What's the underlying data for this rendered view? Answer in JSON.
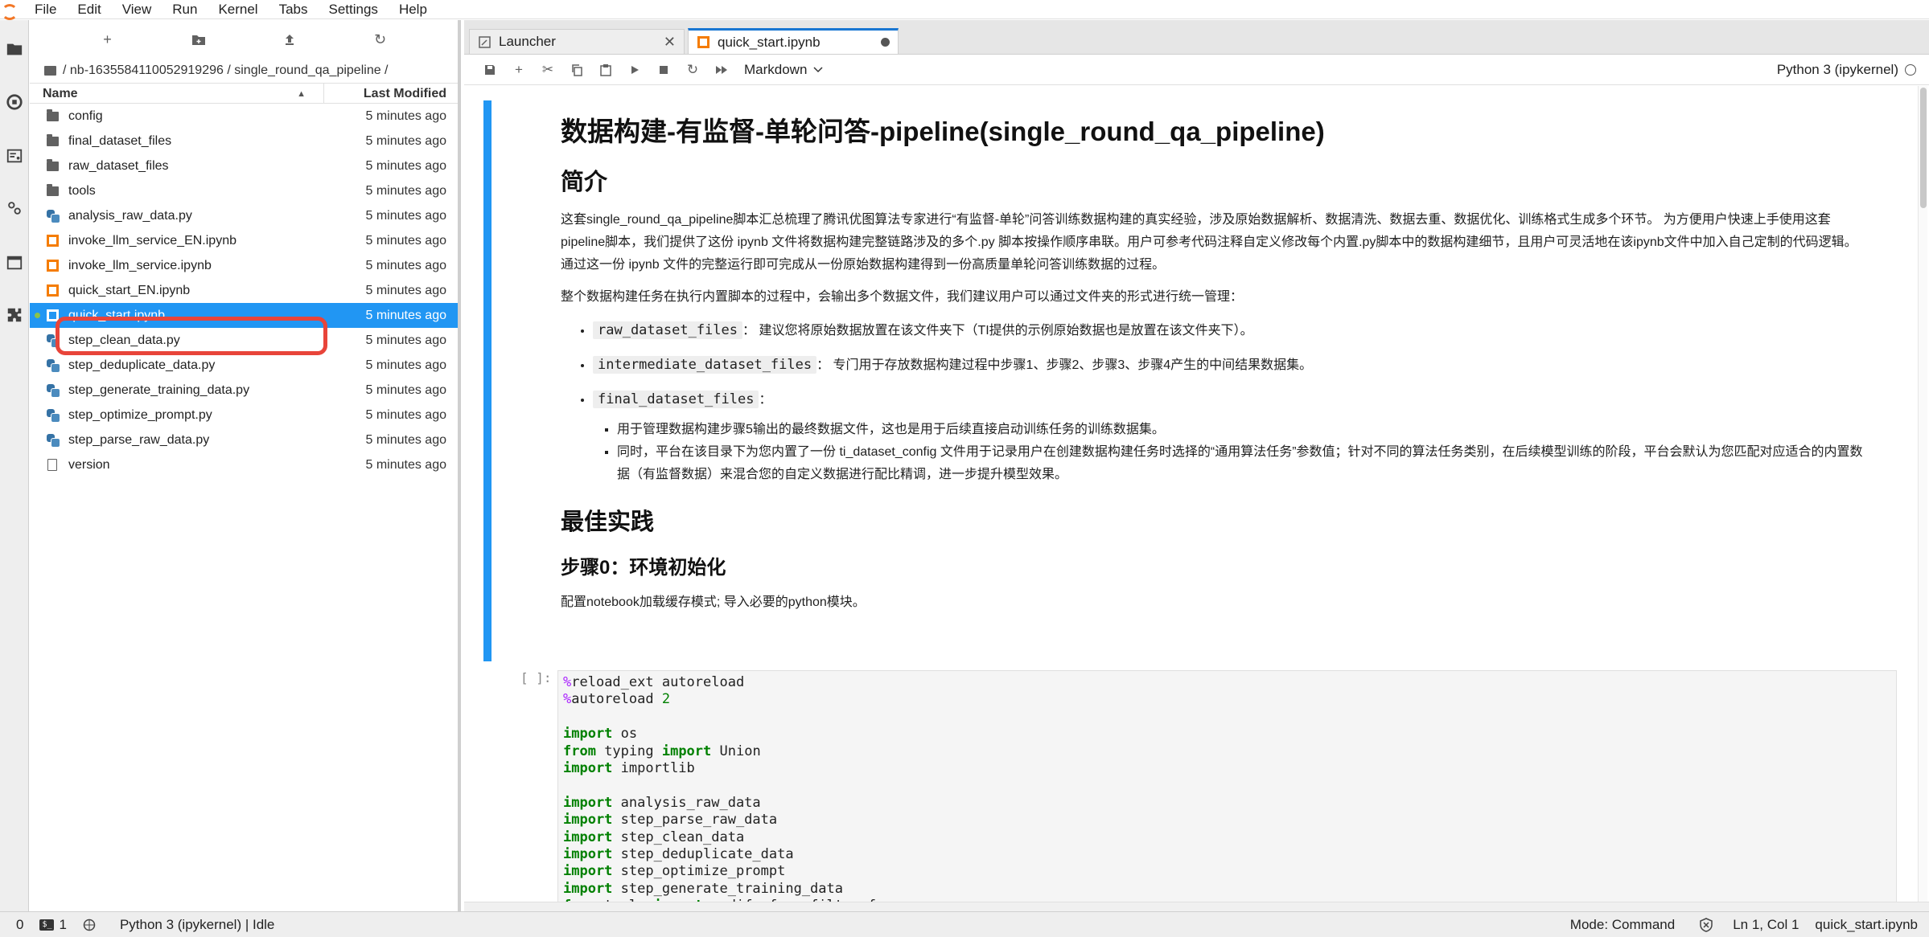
{
  "menu": [
    "File",
    "Edit",
    "View",
    "Run",
    "Kernel",
    "Tabs",
    "Settings",
    "Help"
  ],
  "filebrowser": {
    "path": "/ nb-1635584110052919296 / single_round_qa_pipeline /",
    "col_name": "Name",
    "col_modified": "Last Modified",
    "files": [
      {
        "name": "config",
        "type": "folder",
        "modified": "5 minutes ago"
      },
      {
        "name": "final_dataset_files",
        "type": "folder",
        "modified": "5 minutes ago"
      },
      {
        "name": "raw_dataset_files",
        "type": "folder",
        "modified": "5 minutes ago"
      },
      {
        "name": "tools",
        "type": "folder",
        "modified": "5 minutes ago"
      },
      {
        "name": "analysis_raw_data.py",
        "type": "python",
        "modified": "5 minutes ago"
      },
      {
        "name": "invoke_llm_service_EN.ipynb",
        "type": "notebook",
        "modified": "5 minutes ago"
      },
      {
        "name": "invoke_llm_service.ipynb",
        "type": "notebook",
        "modified": "5 minutes ago"
      },
      {
        "name": "quick_start_EN.ipynb",
        "type": "notebook",
        "modified": "5 minutes ago"
      },
      {
        "name": "quick_start.ipynb",
        "type": "notebook",
        "modified": "5 minutes ago",
        "selected": true
      },
      {
        "name": "step_clean_data.py",
        "type": "python",
        "modified": "5 minutes ago"
      },
      {
        "name": "step_deduplicate_data.py",
        "type": "python",
        "modified": "5 minutes ago"
      },
      {
        "name": "step_generate_training_data.py",
        "type": "python",
        "modified": "5 minutes ago"
      },
      {
        "name": "step_optimize_prompt.py",
        "type": "python",
        "modified": "5 minutes ago"
      },
      {
        "name": "step_parse_raw_data.py",
        "type": "python",
        "modified": "5 minutes ago"
      },
      {
        "name": "version",
        "type": "file",
        "modified": "5 minutes ago"
      }
    ]
  },
  "tabs": {
    "launcher": "Launcher",
    "notebook": "quick_start.ipynb"
  },
  "toolbar": {
    "cell_type": "Markdown",
    "kernel": "Python 3 (ipykernel)"
  },
  "markdown": {
    "h1": "数据构建-有监督-单轮问答-pipeline(single_round_qa_pipeline)",
    "h2_intro": "简介",
    "p1": "这套single_round_qa_pipeline脚本汇总梳理了腾讯优图算法专家进行“有监督-单轮”问答训练数据构建的真实经验，涉及原始数据解析、数据清洗、数据去重、数据优化、训练格式生成多个环节。 为方便用户快速上手使用这套pipeline脚本，我们提供了这份 ipynb 文件将数据构建完整链路涉及的多个.py 脚本按操作顺序串联。用户可参考代码注释自定义修改每个内置.py脚本中的数据构建细节，且用户可灵活地在该ipynb文件中加入自己定制的代码逻辑。 通过这一份 ipynb 文件的完整运行即可完成从一份原始数据构建得到一份高质量单轮问答训练数据的过程。",
    "p2": "整个数据构建任务在执行内置脚本的过程中，会输出多个数据文件，我们建议用户可以通过文件夹的形式进行统一管理：",
    "li1_code": "raw_dataset_files",
    "li1_text": "： 建议您将原始数据放置在该文件夹下（TI提供的示例原始数据也是放置在该文件夹下）。",
    "li2_code": "intermediate_dataset_files",
    "li2_text": "： 专门用于存放数据构建过程中步骤1、步骤2、步骤3、步骤4产生的中间结果数据集。",
    "li3_code": "final_dataset_files",
    "li3_text": "：",
    "sub1": "用于管理数据构建步骤5输出的最终数据文件，这也是用于后续直接启动训练任务的训练数据集。",
    "sub2": "同时，平台在该目录下为您内置了一份 ti_dataset_config 文件用于记录用户在创建数据构建任务时选择的“通用算法任务”参数值；针对不同的算法任务类别，在后续模型训练的阶段，平台会默认为您匹配对应适合的内置数据（有监督数据）来混合您的自定义数据进行配比精调，进一步提升模型效果。",
    "h2_best": "最佳实践",
    "h3_step0": "步骤0：环境初始化",
    "p3": "配置notebook加载缓存模式; 导入必要的python模块。"
  },
  "code_cell": {
    "prompt": "[ ]:"
  },
  "status": {
    "count1": "0",
    "count2": "1",
    "kernel_status": "Python 3 (ipykernel) | Idle",
    "mode": "Mode: Command",
    "position": "Ln 1, Col 1",
    "filename": "quick_start.ipynb"
  },
  "colors": {
    "accent": "#2196f3",
    "highlight": "#e8443a",
    "notebook_icon": "#f57c00"
  }
}
